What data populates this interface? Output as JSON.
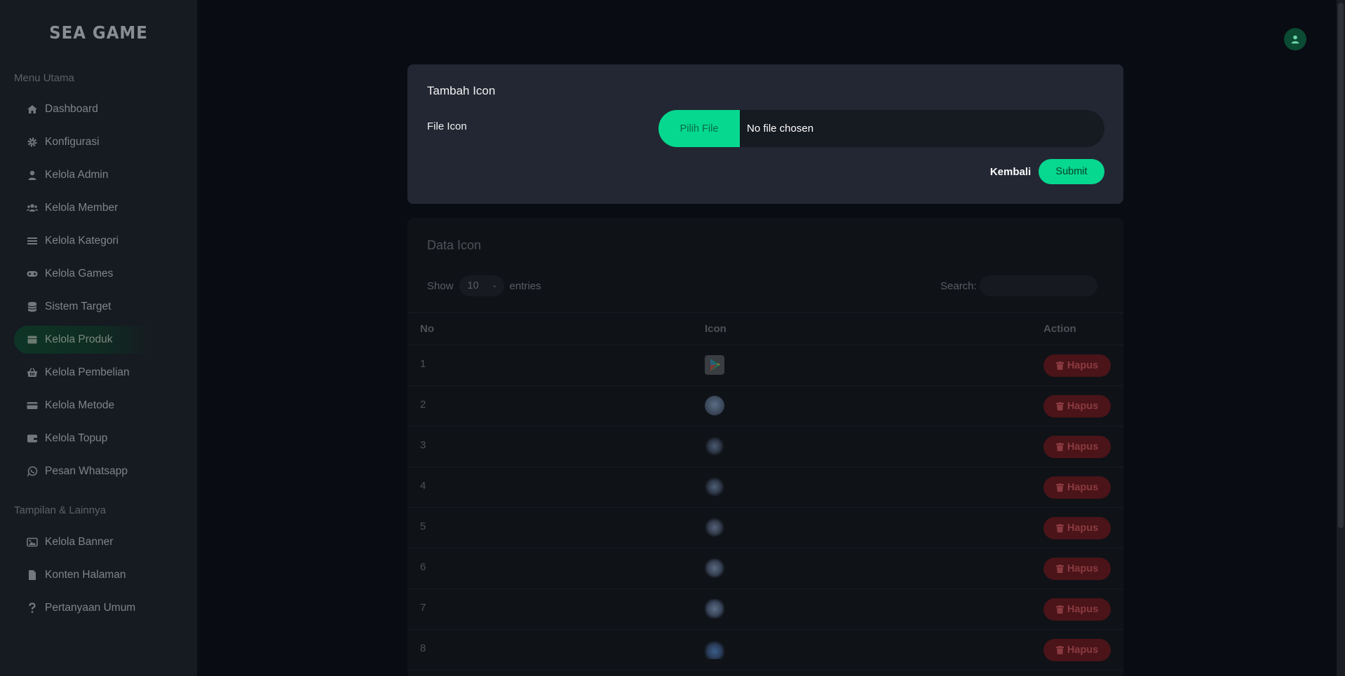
{
  "brand": "SEA GAME",
  "sidebar": {
    "section_main": "Menu Utama",
    "section_other": "Tampilan & Lainnya",
    "items": [
      {
        "label": "Dashboard",
        "icon": "home-icon"
      },
      {
        "label": "Konfigurasi",
        "icon": "gear-icon"
      },
      {
        "label": "Kelola Admin",
        "icon": "user-icon"
      },
      {
        "label": "Kelola Member",
        "icon": "users-icon"
      },
      {
        "label": "Kelola Kategori",
        "icon": "list-icon"
      },
      {
        "label": "Kelola Games",
        "icon": "gamepad-icon"
      },
      {
        "label": "Sistem Target",
        "icon": "database-icon"
      },
      {
        "label": "Kelola Produk",
        "icon": "box-icon",
        "active": true
      },
      {
        "label": "Kelola Pembelian",
        "icon": "basket-icon"
      },
      {
        "label": "Kelola Metode",
        "icon": "credit-card-icon"
      },
      {
        "label": "Kelola Topup",
        "icon": "wallet-icon"
      },
      {
        "label": "Pesan Whatsapp",
        "icon": "whatsapp-icon"
      }
    ],
    "other_items": [
      {
        "label": "Kelola Banner",
        "icon": "image-icon"
      },
      {
        "label": "Konten Halaman",
        "icon": "file-icon"
      },
      {
        "label": "Pertanyaan Umum",
        "icon": "question-icon"
      }
    ]
  },
  "modal": {
    "title": "Tambah Icon",
    "file_label": "File Icon",
    "file_button": "Pilih File",
    "file_status": "No file chosen",
    "back_label": "Kembali",
    "submit_label": "Submit"
  },
  "table_card": {
    "title": "Data Icon",
    "show_label": "Show",
    "entries_value": "10",
    "entries_label": "entries",
    "search_label": "Search:",
    "columns": [
      "No",
      "Icon",
      "Action"
    ],
    "delete_label": "Hapus",
    "rows": [
      {
        "no": "1",
        "icon": "play-store-icon"
      },
      {
        "no": "2",
        "icon": "game-item-icon"
      },
      {
        "no": "3",
        "icon": "game-item-icon"
      },
      {
        "no": "4",
        "icon": "game-item-icon"
      },
      {
        "no": "5",
        "icon": "game-item-icon"
      },
      {
        "no": "6",
        "icon": "game-item-icon"
      },
      {
        "no": "7",
        "icon": "game-item-icon"
      },
      {
        "no": "8",
        "icon": "game-item-icon"
      }
    ]
  },
  "colors": {
    "accent": "#06d88f",
    "danger": "#4a1418",
    "sidebar_bg": "#161a21",
    "modal_bg": "#232733"
  }
}
